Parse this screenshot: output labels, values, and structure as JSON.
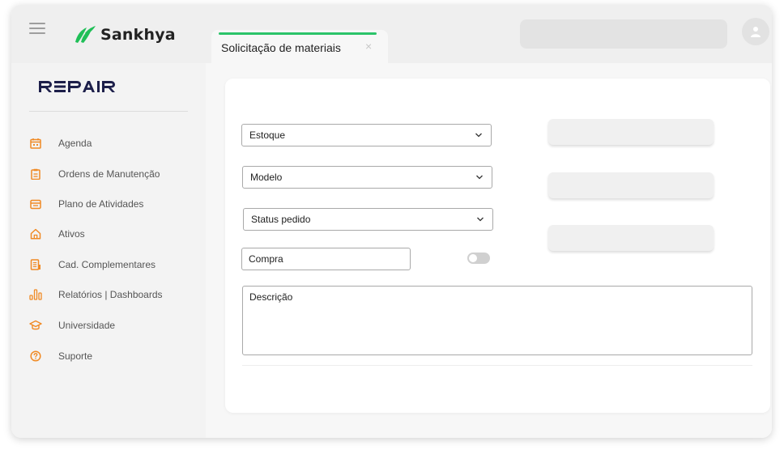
{
  "app": {
    "brand": "Sankhya",
    "module_logo": "REPAIR"
  },
  "tabs": [
    {
      "label": "Solicitação de materiais",
      "active": true,
      "close_icon": "×"
    }
  ],
  "sidebar": {
    "items": [
      {
        "label": "Agenda",
        "icon": "calendar-icon"
      },
      {
        "label": "Ordens de Manutenção",
        "icon": "clipboard-icon"
      },
      {
        "label": "Plano de Atividades",
        "icon": "plan-icon"
      },
      {
        "label": "Ativos",
        "icon": "home-icon"
      },
      {
        "label": "Cad. Complementares",
        "icon": "document-icon"
      },
      {
        "label": "Relatórios | Dashboards",
        "icon": "bar-chart-icon"
      },
      {
        "label": "Universidade",
        "icon": "graduation-cap-icon"
      },
      {
        "label": "Suporte",
        "icon": "help-icon"
      }
    ]
  },
  "form": {
    "estoque": "Estoque",
    "modelo": "Modelo",
    "status_pedido": "Status pedido",
    "compra": "Compra",
    "descricao": "Descrição",
    "compra_toggle_on": false
  },
  "colors": {
    "accent": "#2cc46a",
    "icon_orange": "#f08a24",
    "brand_green": "#1fbf57",
    "repair_navy": "#1d1f4a"
  }
}
